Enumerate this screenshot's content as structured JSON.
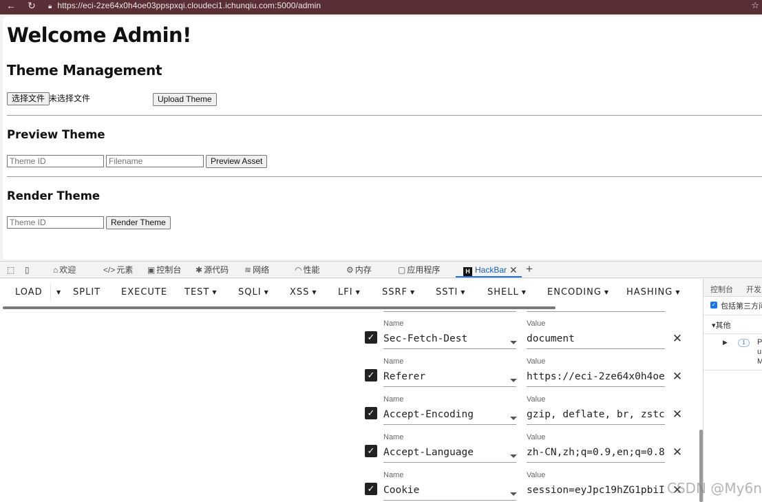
{
  "browser": {
    "back_icon": "arrow-left-icon",
    "reload_icon": "reload-icon",
    "lock_icon": "lock-icon",
    "url": "https://eci-2ze64x0h4oe03ppspxqi.cloudeci1.ichunqiu.com:5000/admin",
    "favorite_icon": "star-icon"
  },
  "page": {
    "heading": "Welcome Admin!",
    "theme_management": {
      "title": "Theme Management",
      "choose_file_label": "选择文件",
      "no_file_text": "未选择文件",
      "upload_label": "Upload Theme"
    },
    "preview": {
      "title": "Preview Theme",
      "theme_id_placeholder": "Theme ID",
      "filename_placeholder": "Filename",
      "button_label": "Preview Asset"
    },
    "render": {
      "title": "Render Theme",
      "theme_id_placeholder": "Theme ID",
      "button_label": "Render Theme"
    }
  },
  "devtools": {
    "tabs": [
      {
        "label": "欢迎",
        "icon": "home-icon"
      },
      {
        "label": "元素",
        "icon": "code-icon"
      },
      {
        "label": "控制台",
        "icon": "console-icon"
      },
      {
        "label": "源代码",
        "icon": "bug-icon"
      },
      {
        "label": "网络",
        "icon": "wifi-icon"
      },
      {
        "label": "性能",
        "icon": "gauge-icon"
      },
      {
        "label": "内存",
        "icon": "chip-icon"
      },
      {
        "label": "应用程序",
        "icon": "window-icon"
      },
      {
        "label": "HackBar",
        "icon": "hackbar-icon"
      }
    ],
    "add_tab_icon": "plus-icon",
    "close_tab_icon": "close-icon"
  },
  "hackbar": {
    "menu": [
      {
        "label": "LOAD",
        "dropdown": false
      },
      {
        "label": "SPLIT",
        "dropdown": false
      },
      {
        "label": "EXECUTE",
        "dropdown": false
      },
      {
        "label": "TEST",
        "dropdown": true
      },
      {
        "label": "SQLI",
        "dropdown": true
      },
      {
        "label": "XSS",
        "dropdown": true
      },
      {
        "label": "LFI",
        "dropdown": true
      },
      {
        "label": "SSRF",
        "dropdown": true
      },
      {
        "label": "SSTI",
        "dropdown": true
      },
      {
        "label": "SHELL",
        "dropdown": true
      },
      {
        "label": "ENCODING",
        "dropdown": true
      },
      {
        "label": "HASHING",
        "dropdown": true
      }
    ],
    "headers": [
      {
        "enabled": true,
        "name_label": "Name",
        "value_label": "Value",
        "name": "Sec-Fetch-Dest",
        "value": "document"
      },
      {
        "enabled": true,
        "name_label": "Name",
        "value_label": "Value",
        "name": "Referer",
        "value": "https://eci-2ze64x0h4oe"
      },
      {
        "enabled": true,
        "name_label": "Name",
        "value_label": "Value",
        "name": "Accept-Encoding",
        "value": "gzip, deflate, br, zstc"
      },
      {
        "enabled": true,
        "name_label": "Name",
        "value_label": "Value",
        "name": "Accept-Language",
        "value": "zh-CN,zh;q=0.9,en;q=0.8"
      },
      {
        "enabled": true,
        "name_label": "Name",
        "value_label": "Value",
        "name": "Cookie",
        "value": "session=eyJpc19hZG1pbiI"
      }
    ]
  },
  "console_pane": {
    "tab1": "控制台",
    "tab2": "开发",
    "include_third_party": "包括第三方问",
    "group": "其他",
    "badge": "1",
    "entry_line1": "P",
    "entry_line2": "u",
    "entry_line3": "M"
  },
  "watermark": "CSDN @My6n"
}
